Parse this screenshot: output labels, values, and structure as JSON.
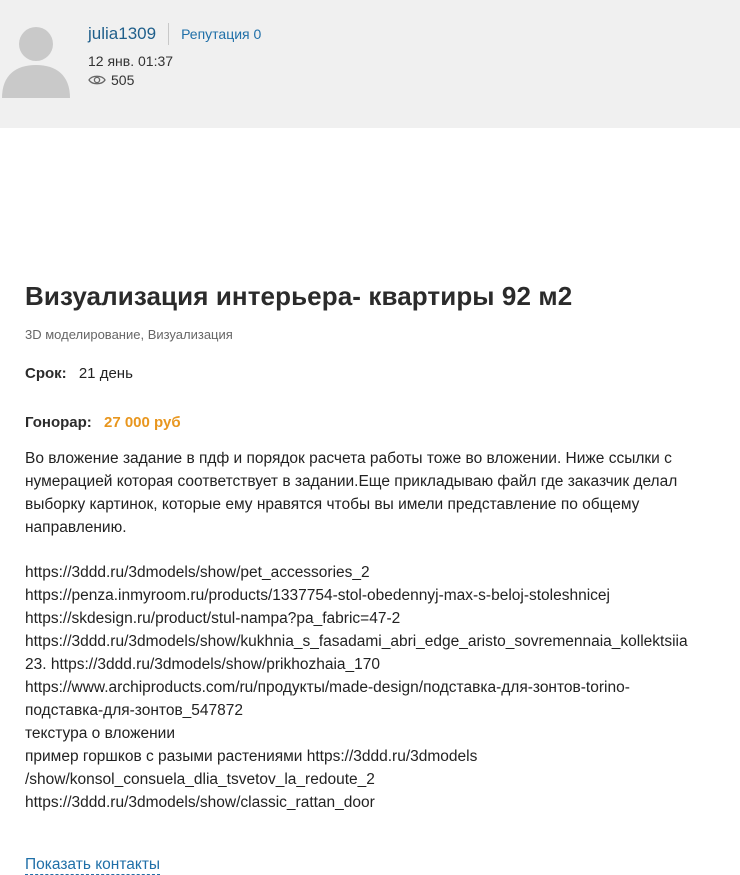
{
  "header": {
    "username": "julia1309",
    "reputation_label": "Репутация 0",
    "date": "12 янв. 01:37",
    "views": "505",
    "icons": {
      "avatar": "user-avatar-placeholder",
      "views": "eye-icon"
    }
  },
  "task": {
    "title": "Визуализация интерьера- квартиры 92 м2",
    "categories": "3D моделирование, Визуализация",
    "deadline_label": "Срок:",
    "deadline_value": "21 день",
    "fee_label": "Гонорар:",
    "fee_value": "27 000 руб",
    "description_lines": [
      "Во вложение задание в пдф и порядок расчета работы тоже во вложении. Ниже ссылки с",
      "нумерацией которая соответствует в задании.Еще прикладываю файл где заказчик делал",
      "выборку картинок, которые ему нравятся чтобы вы имели представление по общему",
      "направлению.",
      "",
      "https://3ddd.ru/3dmodels/show/pet_accessories_2",
      "https://penza.inmyroom.ru/products/1337754-stol-obedennyj-max-s-beloj-stoleshnicej",
      "https://skdesign.ru/product/stul-nampa?pa_fabric=47-2",
      "https://3ddd.ru/3dmodels/show/kukhnia_s_fasadami_abri_edge_aristo_sovremennaia_kollektsiia",
      "23. https://3ddd.ru/3dmodels/show/prikhozhaia_170",
      "https://www.archiproducts.com/ru/продукты/made-design/подставка-для-зонтов-torino-",
      "подставка-для-зонтов_547872",
      "текстура о вложении",
      "пример горшков с разыми растениями https://3ddd.ru/3dmodels",
      "/show/konsol_consuela_dlia_tsvetov_la_redoute_2",
      "https://3ddd.ru/3dmodels/show/classic_rattan_door"
    ],
    "contacts_link": "Показать контакты"
  },
  "colors": {
    "header_bg": "#f0f0f0",
    "link": "#1f6fa8",
    "username": "#1f5f8b",
    "fee": "#e8961e"
  }
}
